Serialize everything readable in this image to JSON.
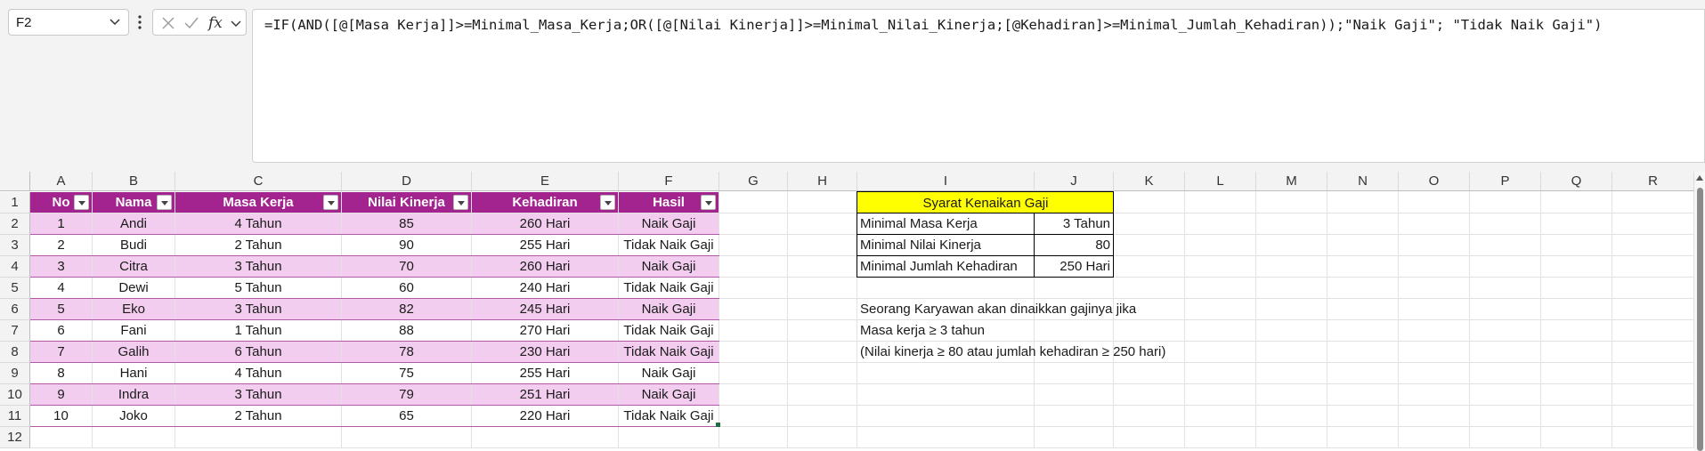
{
  "formula_bar": {
    "name_box": "F2",
    "formula": "=IF(AND([@[Masa Kerja]]>=Minimal_Masa_Kerja;OR([@[Nilai Kinerja]]>=Minimal_Nilai_Kinerja;[@Kehadiran]>=Minimal_Jumlah_Kehadiran));\"Naik Gaji\"; \"Tidak Naik Gaji\")"
  },
  "columns": [
    "A",
    "B",
    "C",
    "D",
    "E",
    "F",
    "G",
    "H",
    "I",
    "J",
    "K",
    "L",
    "M",
    "N",
    "O",
    "P",
    "Q",
    "R"
  ],
  "rows": [
    "1",
    "2",
    "3",
    "4",
    "5",
    "6",
    "7",
    "8",
    "9",
    "10",
    "11",
    "12"
  ],
  "table": {
    "headers": [
      "No",
      "Nama",
      "Masa Kerja",
      "Nilai Kinerja",
      "Kehadiran",
      "Hasil"
    ],
    "rows": [
      [
        "1",
        "Andi",
        "4 Tahun",
        "85",
        "260 Hari",
        "Naik Gaji"
      ],
      [
        "2",
        "Budi",
        "2 Tahun",
        "90",
        "255 Hari",
        "Tidak Naik Gaji"
      ],
      [
        "3",
        "Citra",
        "3 Tahun",
        "70",
        "260 Hari",
        "Naik Gaji"
      ],
      [
        "4",
        "Dewi",
        "5 Tahun",
        "60",
        "240 Hari",
        "Tidak Naik Gaji"
      ],
      [
        "5",
        "Eko",
        "3 Tahun",
        "82",
        "245 Hari",
        "Naik Gaji"
      ],
      [
        "6",
        "Fani",
        "1 Tahun",
        "88",
        "270 Hari",
        "Tidak Naik Gaji"
      ],
      [
        "7",
        "Galih",
        "6 Tahun",
        "78",
        "230 Hari",
        "Tidak Naik Gaji"
      ],
      [
        "8",
        "Hani",
        "4 Tahun",
        "75",
        "255 Hari",
        "Naik Gaji"
      ],
      [
        "9",
        "Indra",
        "3 Tahun",
        "79",
        "251 Hari",
        "Naik Gaji"
      ],
      [
        "10",
        "Joko",
        "2 Tahun",
        "65",
        "220 Hari",
        "Tidak Naik Gaji"
      ]
    ]
  },
  "criteria": {
    "title": "Syarat Kenaikan Gaji",
    "items": [
      {
        "label": "Minimal Masa Kerja",
        "value": "3 Tahun"
      },
      {
        "label": "Minimal Nilai Kinerja",
        "value": "80"
      },
      {
        "label": "Minimal Jumlah Kehadiran",
        "value": "250 Hari"
      }
    ]
  },
  "notes": [
    "Seorang Karyawan akan dinaikkan gajinya jika",
    "Masa kerja ≥ 3 tahun",
    "(Nilai kinerja ≥ 80 atau jumlah kehadiran ≥ 250 hari)"
  ],
  "colors": {
    "table_header": "#a3238f",
    "table_band": "#f3cdef",
    "criteria_title_bg": "#ffff00"
  },
  "icons": {
    "cancel": "x-icon",
    "enter": "checkmark-icon",
    "function": "fx-icon"
  }
}
